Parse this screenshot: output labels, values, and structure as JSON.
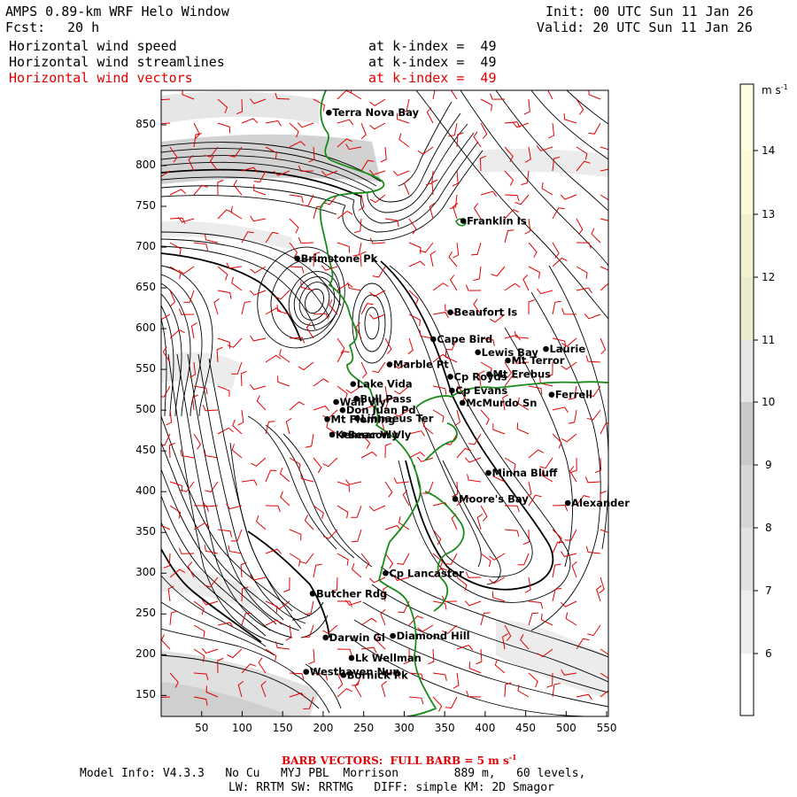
{
  "header": {
    "title": "AMPS 0.89-km WRF Helo Window",
    "fcst_label": "Fcst:",
    "fcst_value": "20 h",
    "init": "Init: 00 UTC Sun 11 Jan 26",
    "valid": "Valid: 20 UTC Sun 11 Jan 26",
    "fields": [
      {
        "name": "Horizontal wind speed",
        "level": "at k-index =  49"
      },
      {
        "name": "Horizontal wind streamlines",
        "level": "at k-index =  49"
      },
      {
        "name": "Horizontal wind vectors",
        "level": "at k-index =  49"
      }
    ]
  },
  "colorbar": {
    "units": "m s",
    "units_sup": "-1",
    "ticks": [
      "14",
      "13",
      "12",
      "11",
      "10",
      "9",
      "8",
      "7",
      "6"
    ]
  },
  "axes": {
    "x_ticks": [
      "50",
      "100",
      "150",
      "200",
      "250",
      "300",
      "350",
      "400",
      "450",
      "500",
      "550"
    ],
    "y_ticks": [
      "850",
      "800",
      "750",
      "700",
      "650",
      "600",
      "550",
      "500",
      "450",
      "400",
      "350",
      "300",
      "250",
      "200",
      "150"
    ]
  },
  "places": [
    {
      "name": "Terra Nova Bay",
      "x": 207,
      "y": 865
    },
    {
      "name": "Franklin Is",
      "x": 373,
      "y": 732
    },
    {
      "name": "Brimstone Pk",
      "x": 168,
      "y": 686
    },
    {
      "name": "Beaufort Is",
      "x": 357,
      "y": 620
    },
    {
      "name": "Cape Bird",
      "x": 336,
      "y": 587
    },
    {
      "name": "Lewis Bay",
      "x": 391,
      "y": 571
    },
    {
      "name": "Laurie",
      "x": 475,
      "y": 575
    },
    {
      "name": "Marble Pt",
      "x": 282,
      "y": 556
    },
    {
      "name": "Mt Terror",
      "x": 428,
      "y": 561
    },
    {
      "name": "Cp Royds",
      "x": 357,
      "y": 541
    },
    {
      "name": "Mt Erebus",
      "x": 405,
      "y": 544
    },
    {
      "name": "Lake Vida",
      "x": 237,
      "y": 532
    },
    {
      "name": "Cp Evans",
      "x": 359,
      "y": 524
    },
    {
      "name": "Wall Vly",
      "x": 216,
      "y": 510
    },
    {
      "name": "Ferrell",
      "x": 482,
      "y": 519
    },
    {
      "name": "Bull Pass",
      "x": 241,
      "y": 514
    },
    {
      "name": "McMurdo Sn",
      "x": 372,
      "y": 509
    },
    {
      "name": "Don Juan Pd",
      "x": 224,
      "y": 500
    },
    {
      "name": "Mt Fleming",
      "x": 205,
      "y": 489
    },
    {
      "name": "Linnaeus Ter",
      "x": 242,
      "y": 490
    },
    {
      "name": "Kennar Vly",
      "x": 211,
      "y": 470
    },
    {
      "name": "Beacon Vly",
      "x": 226,
      "y": 470
    },
    {
      "name": "Minna Bluff",
      "x": 404,
      "y": 423
    },
    {
      "name": "Moore's Bay",
      "x": 363,
      "y": 391
    },
    {
      "name": "Alexander",
      "x": 502,
      "y": 386
    },
    {
      "name": "Cp Lancaster",
      "x": 277,
      "y": 300
    },
    {
      "name": "Butcher Rdg",
      "x": 187,
      "y": 275
    },
    {
      "name": "Diamond Hill",
      "x": 286,
      "y": 223
    },
    {
      "name": "Darwin Gl",
      "x": 203,
      "y": 221
    },
    {
      "name": "Lk Wellman",
      "x": 235,
      "y": 196
    },
    {
      "name": "Westhaven Nun",
      "x": 179,
      "y": 179
    },
    {
      "name": "Bornick Pk",
      "x": 225,
      "y": 175
    }
  ],
  "footer": {
    "barb_label": "BARB VECTORS:  FULL BARB = 5 m s",
    "barb_sup": "-1",
    "model_info_1": "Model Info: V4.3.3   No Cu   MYJ PBL  Morrison        889 m,   60 levels,",
    "model_info_2": "LW: RRTM SW: RRTMG   DIFF: simple KM: 2D Smagor"
  },
  "colors": {
    "coastline": "#1a8a1a",
    "barbs": "#e00000",
    "streamlines": "#000000",
    "shade_light": "#ececec",
    "shade_mid": "#d2d2d2",
    "shade_dark": "#b4b4b4"
  }
}
